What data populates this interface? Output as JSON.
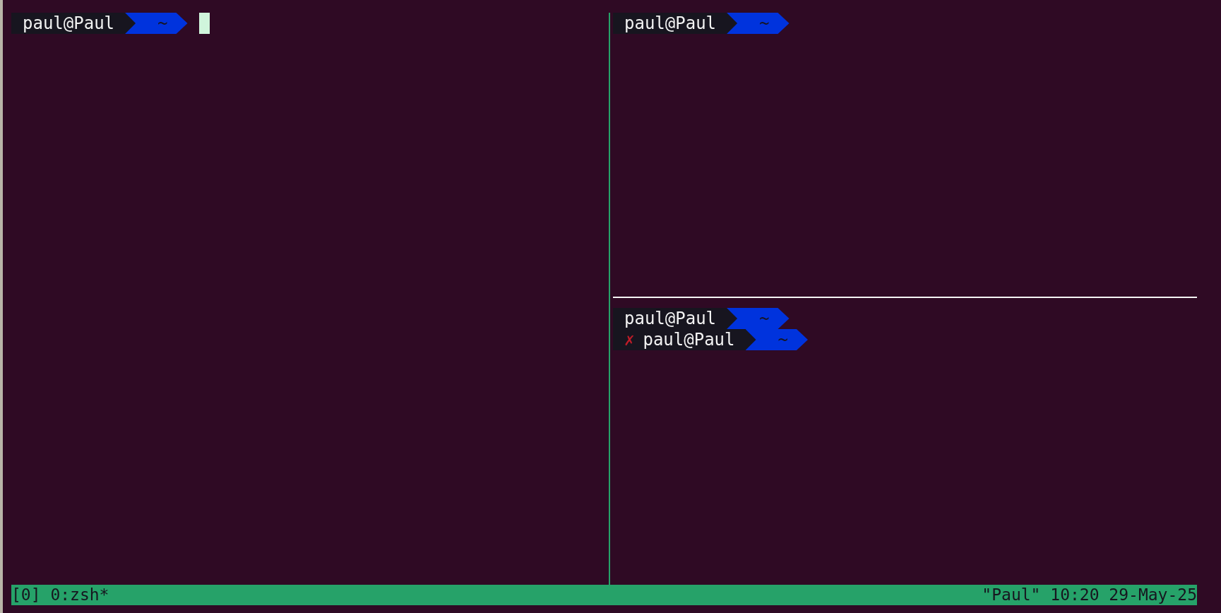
{
  "panes": [
    {
      "lines": [
        {
          "kind": "prompt",
          "user": "paul@Paul",
          "dir": "~",
          "cursor": true
        }
      ]
    },
    {
      "lines": [
        {
          "kind": "prompt",
          "user": "paul@Paul",
          "dir": "~",
          "cursor": false
        }
      ]
    },
    {
      "lines": [
        {
          "kind": "prompt",
          "user": "paul@Paul",
          "dir": "~",
          "cursor": false
        },
        {
          "kind": "prompt",
          "mark": "✗",
          "user": "paul@Paul",
          "dir": "~",
          "cursor": false
        }
      ]
    }
  ],
  "status_bar": {
    "left": "[0] 0:zsh*",
    "right": "\"Paul\" 10:20 29-May-25"
  }
}
